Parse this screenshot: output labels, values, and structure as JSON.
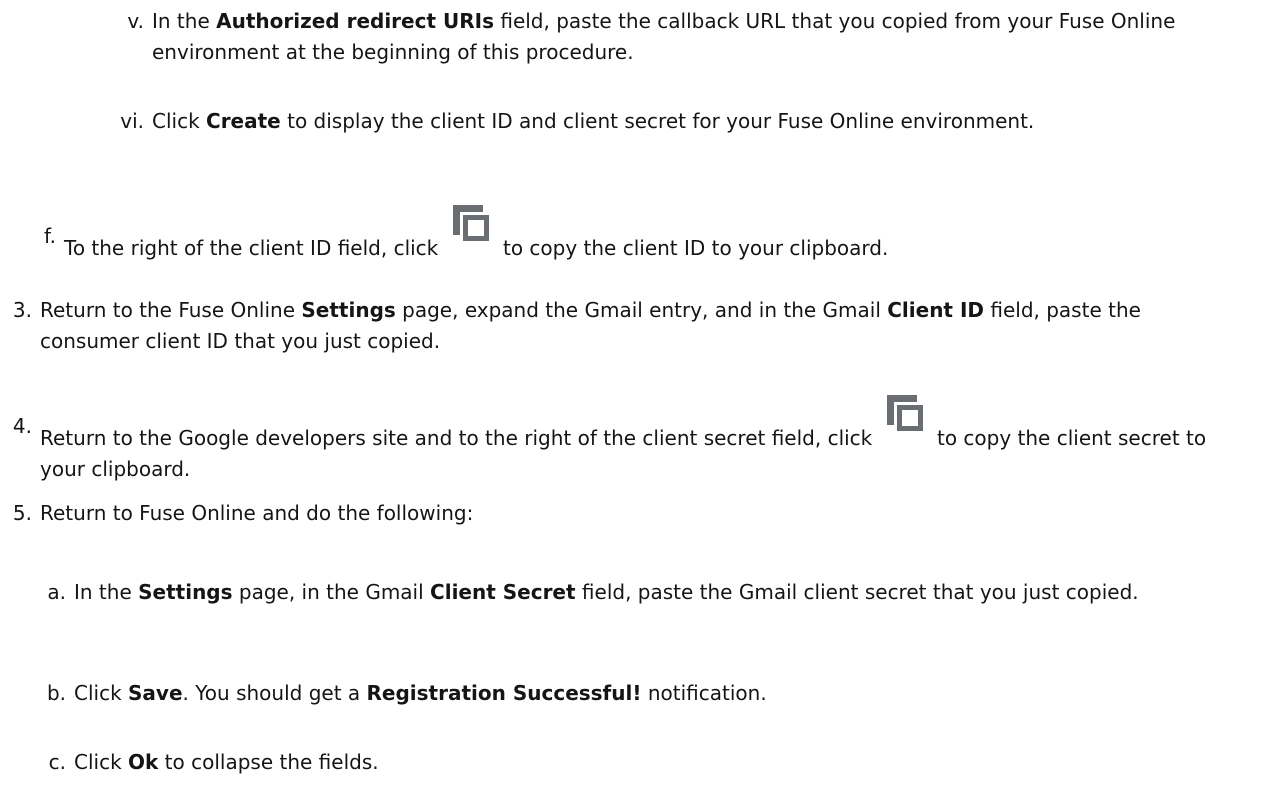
{
  "steps": {
    "v": {
      "marker": "v.",
      "t1": "In the ",
      "b1": "Authorized redirect URIs",
      "t2": " field, paste the callback URL that you copied from your Fuse Online environment at the beginning of this procedure."
    },
    "vi": {
      "marker": "vi.",
      "t1": "Click ",
      "b1": "Create",
      "t2": " to display the client ID and client secret for your Fuse Online environment."
    },
    "f": {
      "marker": "f.",
      "t1": "To the right of the client ID field, click ",
      "icon": "copy-icon",
      "t2": " to copy the client ID to your clipboard."
    },
    "s3": {
      "marker": "3.",
      "t1": "Return to the Fuse Online ",
      "b1": "Settings",
      "t2": " page, expand the Gmail entry, and in the Gmail ",
      "b2": "Client ID",
      "t3": " field, paste the consumer client ID that you just copied."
    },
    "s4": {
      "marker": "4.",
      "t1": "Return to the Google developers site and to the right of the client secret field, click ",
      "icon": "copy-icon",
      "t2": " to copy the client secret to your clipboard."
    },
    "s5": {
      "marker": "5.",
      "t1": "Return to Fuse Online and do the following:"
    },
    "a": {
      "marker": "a.",
      "t1": "In the ",
      "b1": "Settings",
      "t2": " page, in the Gmail ",
      "b2": "Client Secret",
      "t3": " field, paste the Gmail client secret that you just copied."
    },
    "b": {
      "marker": "b.",
      "t1": "Click ",
      "b1": "Save",
      "t2": ". You should get a ",
      "b2": "Registration Successful!",
      "t3": " notification."
    },
    "c": {
      "marker": "c.",
      "t1": "Click ",
      "b1": "Ok",
      "t2": " to collapse the fields."
    }
  },
  "colors": {
    "text": "#151515",
    "icon": "#6a6e73"
  }
}
